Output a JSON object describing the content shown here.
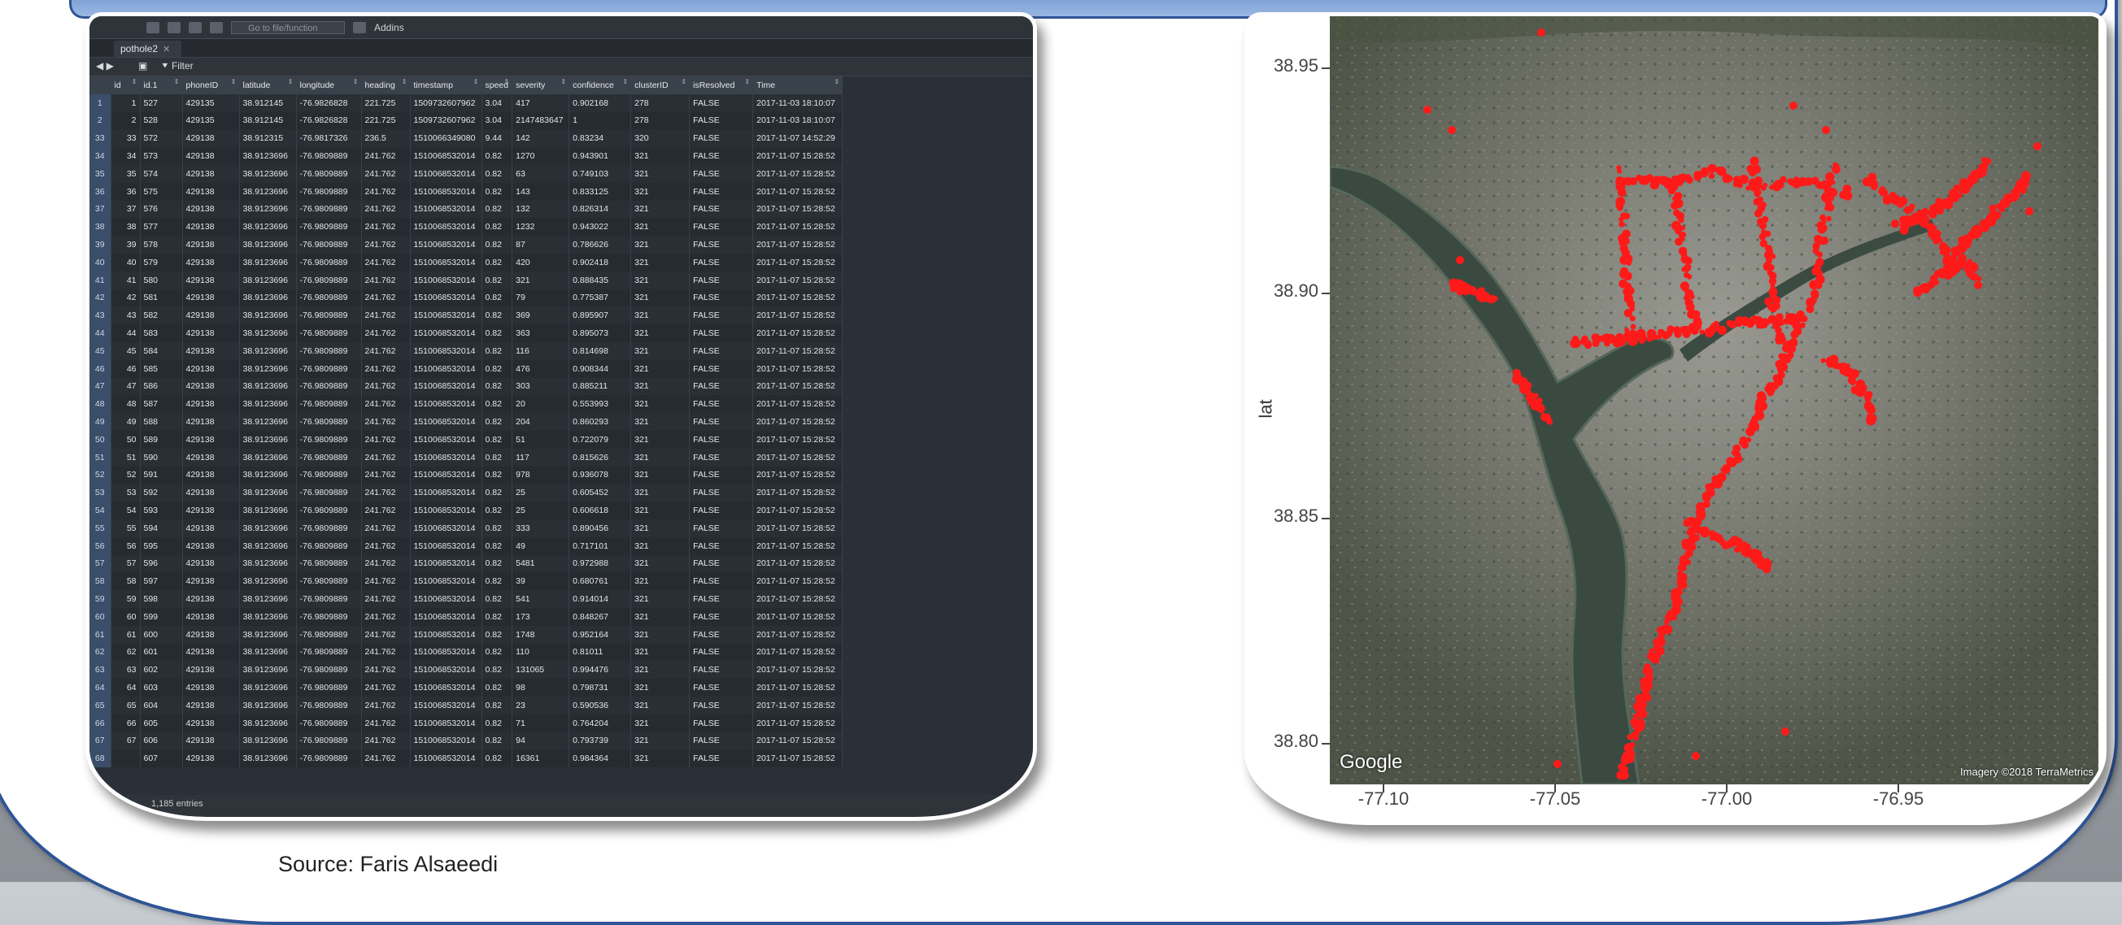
{
  "toolbar": {
    "goto_placeholder": "Go to file/function",
    "addins": "Addins"
  },
  "tab": {
    "name": "pothole2"
  },
  "filterbar": {
    "filter_label": "Filter"
  },
  "table": {
    "columns": [
      "",
      "id",
      "id.1",
      "phoneID",
      "latitude",
      "longitude",
      "heading",
      "timestamp",
      "speed",
      "severity",
      "confidence",
      "clusterID",
      "isResolved",
      "Time"
    ],
    "rows": [
      [
        "1",
        "1",
        "527",
        "429135",
        "38.912145",
        "-76.9826828",
        "221.725",
        "1509732607962",
        "3.04",
        "417",
        "0.902168",
        "278",
        "FALSE",
        "2017-11-03 18:10:07"
      ],
      [
        "2",
        "2",
        "528",
        "429135",
        "38.912145",
        "-76.9826828",
        "221.725",
        "1509732607962",
        "3.04",
        "2147483647",
        "1",
        "278",
        "FALSE",
        "2017-11-03 18:10:07"
      ],
      [
        "33",
        "33",
        "572",
        "429138",
        "38.912315",
        "-76.9817326",
        "236.5",
        "1510066349080",
        "9.44",
        "142",
        "0.83234",
        "320",
        "FALSE",
        "2017-11-07 14:52:29"
      ],
      [
        "34",
        "34",
        "573",
        "429138",
        "38.9123696",
        "-76.9809889",
        "241.762",
        "1510068532014",
        "0.82",
        "1270",
        "0.943901",
        "321",
        "FALSE",
        "2017-11-07 15:28:52"
      ],
      [
        "35",
        "35",
        "574",
        "429138",
        "38.9123696",
        "-76.9809889",
        "241.762",
        "1510068532014",
        "0.82",
        "63",
        "0.749103",
        "321",
        "FALSE",
        "2017-11-07 15:28:52"
      ],
      [
        "36",
        "36",
        "575",
        "429138",
        "38.9123696",
        "-76.9809889",
        "241.762",
        "1510068532014",
        "0.82",
        "143",
        "0.833125",
        "321",
        "FALSE",
        "2017-11-07 15:28:52"
      ],
      [
        "37",
        "37",
        "576",
        "429138",
        "38.9123696",
        "-76.9809889",
        "241.762",
        "1510068532014",
        "0.82",
        "132",
        "0.826314",
        "321",
        "FALSE",
        "2017-11-07 15:28:52"
      ],
      [
        "38",
        "38",
        "577",
        "429138",
        "38.9123696",
        "-76.9809889",
        "241.762",
        "1510068532014",
        "0.82",
        "1232",
        "0.943022",
        "321",
        "FALSE",
        "2017-11-07 15:28:52"
      ],
      [
        "39",
        "39",
        "578",
        "429138",
        "38.9123696",
        "-76.9809889",
        "241.762",
        "1510068532014",
        "0.82",
        "87",
        "0.786626",
        "321",
        "FALSE",
        "2017-11-07 15:28:52"
      ],
      [
        "40",
        "40",
        "579",
        "429138",
        "38.9123696",
        "-76.9809889",
        "241.762",
        "1510068532014",
        "0.82",
        "420",
        "0.902418",
        "321",
        "FALSE",
        "2017-11-07 15:28:52"
      ],
      [
        "41",
        "41",
        "580",
        "429138",
        "38.9123696",
        "-76.9809889",
        "241.762",
        "1510068532014",
        "0.82",
        "321",
        "0.888435",
        "321",
        "FALSE",
        "2017-11-07 15:28:52"
      ],
      [
        "42",
        "42",
        "581",
        "429138",
        "38.9123696",
        "-76.9809889",
        "241.762",
        "1510068532014",
        "0.82",
        "79",
        "0.775387",
        "321",
        "FALSE",
        "2017-11-07 15:28:52"
      ],
      [
        "43",
        "43",
        "582",
        "429138",
        "38.9123696",
        "-76.9809889",
        "241.762",
        "1510068532014",
        "0.82",
        "369",
        "0.895907",
        "321",
        "FALSE",
        "2017-11-07 15:28:52"
      ],
      [
        "44",
        "44",
        "583",
        "429138",
        "38.9123696",
        "-76.9809889",
        "241.762",
        "1510068532014",
        "0.82",
        "363",
        "0.895073",
        "321",
        "FALSE",
        "2017-11-07 15:28:52"
      ],
      [
        "45",
        "45",
        "584",
        "429138",
        "38.9123696",
        "-76.9809889",
        "241.762",
        "1510068532014",
        "0.82",
        "116",
        "0.814698",
        "321",
        "FALSE",
        "2017-11-07 15:28:52"
      ],
      [
        "46",
        "46",
        "585",
        "429138",
        "38.9123696",
        "-76.9809889",
        "241.762",
        "1510068532014",
        "0.82",
        "476",
        "0.908344",
        "321",
        "FALSE",
        "2017-11-07 15:28:52"
      ],
      [
        "47",
        "47",
        "586",
        "429138",
        "38.9123696",
        "-76.9809889",
        "241.762",
        "1510068532014",
        "0.82",
        "303",
        "0.885211",
        "321",
        "FALSE",
        "2017-11-07 15:28:52"
      ],
      [
        "48",
        "48",
        "587",
        "429138",
        "38.9123696",
        "-76.9809889",
        "241.762",
        "1510068532014",
        "0.82",
        "20",
        "0.553993",
        "321",
        "FALSE",
        "2017-11-07 15:28:52"
      ],
      [
        "49",
        "49",
        "588",
        "429138",
        "38.9123696",
        "-76.9809889",
        "241.762",
        "1510068532014",
        "0.82",
        "204",
        "0.860293",
        "321",
        "FALSE",
        "2017-11-07 15:28:52"
      ],
      [
        "50",
        "50",
        "589",
        "429138",
        "38.9123696",
        "-76.9809889",
        "241.762",
        "1510068532014",
        "0.82",
        "51",
        "0.722079",
        "321",
        "FALSE",
        "2017-11-07 15:28:52"
      ],
      [
        "51",
        "51",
        "590",
        "429138",
        "38.9123696",
        "-76.9809889",
        "241.762",
        "1510068532014",
        "0.82",
        "117",
        "0.815626",
        "321",
        "FALSE",
        "2017-11-07 15:28:52"
      ],
      [
        "52",
        "52",
        "591",
        "429138",
        "38.9123696",
        "-76.9809889",
        "241.762",
        "1510068532014",
        "0.82",
        "978",
        "0.936078",
        "321",
        "FALSE",
        "2017-11-07 15:28:52"
      ],
      [
        "53",
        "53",
        "592",
        "429138",
        "38.9123696",
        "-76.9809889",
        "241.762",
        "1510068532014",
        "0.82",
        "25",
        "0.605452",
        "321",
        "FALSE",
        "2017-11-07 15:28:52"
      ],
      [
        "54",
        "54",
        "593",
        "429138",
        "38.9123696",
        "-76.9809889",
        "241.762",
        "1510068532014",
        "0.82",
        "25",
        "0.606618",
        "321",
        "FALSE",
        "2017-11-07 15:28:52"
      ],
      [
        "55",
        "55",
        "594",
        "429138",
        "38.9123696",
        "-76.9809889",
        "241.762",
        "1510068532014",
        "0.82",
        "333",
        "0.890456",
        "321",
        "FALSE",
        "2017-11-07 15:28:52"
      ],
      [
        "56",
        "56",
        "595",
        "429138",
        "38.9123696",
        "-76.9809889",
        "241.762",
        "1510068532014",
        "0.82",
        "49",
        "0.717101",
        "321",
        "FALSE",
        "2017-11-07 15:28:52"
      ],
      [
        "57",
        "57",
        "596",
        "429138",
        "38.9123696",
        "-76.9809889",
        "241.762",
        "1510068532014",
        "0.82",
        "5481",
        "0.972988",
        "321",
        "FALSE",
        "2017-11-07 15:28:52"
      ],
      [
        "58",
        "58",
        "597",
        "429138",
        "38.9123696",
        "-76.9809889",
        "241.762",
        "1510068532014",
        "0.82",
        "39",
        "0.680761",
        "321",
        "FALSE",
        "2017-11-07 15:28:52"
      ],
      [
        "59",
        "59",
        "598",
        "429138",
        "38.9123696",
        "-76.9809889",
        "241.762",
        "1510068532014",
        "0.82",
        "541",
        "0.914014",
        "321",
        "FALSE",
        "2017-11-07 15:28:52"
      ],
      [
        "60",
        "60",
        "599",
        "429138",
        "38.9123696",
        "-76.9809889",
        "241.762",
        "1510068532014",
        "0.82",
        "173",
        "0.848267",
        "321",
        "FALSE",
        "2017-11-07 15:28:52"
      ],
      [
        "61",
        "61",
        "600",
        "429138",
        "38.9123696",
        "-76.9809889",
        "241.762",
        "1510068532014",
        "0.82",
        "1748",
        "0.952164",
        "321",
        "FALSE",
        "2017-11-07 15:28:52"
      ],
      [
        "62",
        "62",
        "601",
        "429138",
        "38.9123696",
        "-76.9809889",
        "241.762",
        "1510068532014",
        "0.82",
        "110",
        "0.81011",
        "321",
        "FALSE",
        "2017-11-07 15:28:52"
      ],
      [
        "63",
        "63",
        "602",
        "429138",
        "38.9123696",
        "-76.9809889",
        "241.762",
        "1510068532014",
        "0.82",
        "131065",
        "0.994476",
        "321",
        "FALSE",
        "2017-11-07 15:28:52"
      ],
      [
        "64",
        "64",
        "603",
        "429138",
        "38.9123696",
        "-76.9809889",
        "241.762",
        "1510068532014",
        "0.82",
        "98",
        "0.798731",
        "321",
        "FALSE",
        "2017-11-07 15:28:52"
      ],
      [
        "65",
        "65",
        "604",
        "429138",
        "38.9123696",
        "-76.9809889",
        "241.762",
        "1510068532014",
        "0.82",
        "23",
        "0.590536",
        "321",
        "FALSE",
        "2017-11-07 15:28:52"
      ],
      [
        "66",
        "66",
        "605",
        "429138",
        "38.9123696",
        "-76.9809889",
        "241.762",
        "1510068532014",
        "0.82",
        "71",
        "0.764204",
        "321",
        "FALSE",
        "2017-11-07 15:28:52"
      ],
      [
        "67",
        "67",
        "606",
        "429138",
        "38.9123696",
        "-76.9809889",
        "241.762",
        "1510068532014",
        "0.82",
        "94",
        "0.793739",
        "321",
        "FALSE",
        "2017-11-07 15:28:52"
      ],
      [
        "68",
        "",
        "607",
        "429138",
        "38.9123696",
        "-76.9809889",
        "241.762",
        "1510068532014",
        "0.82",
        "16361",
        "0.984364",
        "321",
        "FALSE",
        "2017-11-07 15:28:52"
      ]
    ],
    "entries_text": "1,185 entries"
  },
  "map": {
    "y_title": "lat",
    "y_ticks": [
      "38.95",
      "38.90",
      "38.85",
      "38.80"
    ],
    "x_ticks": [
      "-77.10",
      "-77.05",
      "-77.00",
      "-76.95"
    ],
    "google": "Google",
    "imagery": "Imagery ©2018 TerraMetrics",
    "point_color": "#ff1a1a"
  },
  "source": "Source: Faris Alsaeedi"
}
